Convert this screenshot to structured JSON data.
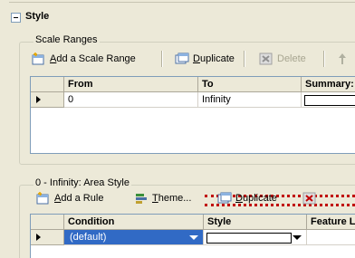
{
  "style_header": {
    "title": "Style"
  },
  "scale_ranges": {
    "group_label": "Scale Ranges",
    "toolbar": {
      "add_label_prefix": "",
      "add_label_u": "A",
      "add_label_rest": "dd a Scale Range",
      "duplicate_u": "D",
      "duplicate_rest": "uplicate",
      "delete_label": "Delete"
    },
    "columns": [
      "From",
      "To",
      "Summary: Area"
    ],
    "rows": [
      {
        "from": "0",
        "to": "Infinity",
        "summary": ""
      }
    ]
  },
  "area_style": {
    "group_label": "0 - Infinity: Area Style",
    "toolbar": {
      "add_rule_u": "A",
      "add_rule_rest": "dd a Rule",
      "theme_u": "T",
      "theme_rest": "heme...",
      "duplicate_u": "D",
      "duplicate_rest": "uplicate"
    },
    "columns": [
      "Condition",
      "Style",
      "Feature Label"
    ],
    "rows": [
      {
        "condition": "(default)",
        "style": "",
        "feature_label": ""
      }
    ]
  },
  "colors": {
    "selection": "#316ac5",
    "panel": "#ece9d8",
    "border": "#7f9db9"
  }
}
